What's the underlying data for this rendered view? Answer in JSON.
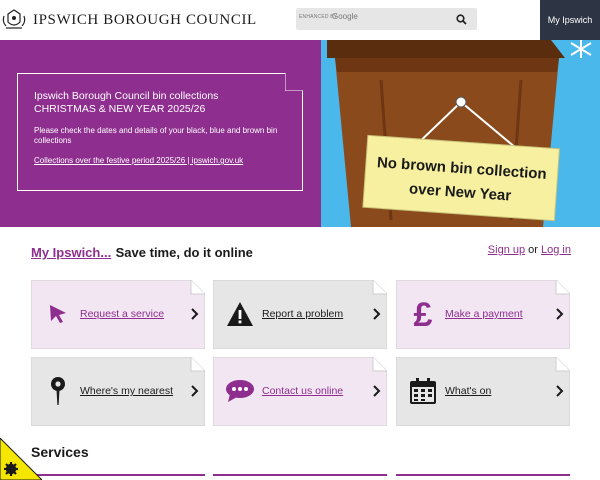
{
  "header": {
    "logo_text": "IPSWICH BOROUGH COUNCIL",
    "search": {
      "badge": "ENHANCED BY",
      "brand": "Google",
      "placeholder": ""
    },
    "my_ipswich_label": "My Ipswich"
  },
  "banner": {
    "title": "Ipswich Borough Council bin collections CHRISTMAS & NEW YEAR 2025/26",
    "description": "Please check the dates and details of your black, blue and brown bin collections",
    "link_text": "Collections over the festive period 2025/26 | ipswich.gov.uk",
    "sign_text_line1": "No brown bin collection",
    "sign_text_line2": "over New Year"
  },
  "my_ipswich_row": {
    "link_text": "My Ipswich...",
    "tagline": "Save time, do it online",
    "sign_up": "Sign up",
    "or": "or",
    "log_in": "Log in"
  },
  "tiles": [
    {
      "label": "Request a service",
      "icon": "cursor-arrow-icon",
      "bg": "#f1e6f1",
      "label_color": "purple"
    },
    {
      "label": "Report a problem",
      "icon": "warning-icon",
      "bg": "#e6e6e6",
      "label_color": "dark"
    },
    {
      "label": "Make a payment",
      "icon": "pound-icon",
      "bg": "#f1e6f1",
      "label_color": "purple"
    },
    {
      "label": "Where's my nearest",
      "icon": "map-pin-icon",
      "bg": "#e6e6e6",
      "label_color": "dark"
    },
    {
      "label": "Contact us online",
      "icon": "chat-icon",
      "bg": "#f1e6f1",
      "label_color": "purple"
    },
    {
      "label": "What's on",
      "icon": "calendar-icon",
      "bg": "#e6e6e6",
      "label_color": "dark"
    }
  ],
  "services": {
    "title": "Services"
  },
  "colors": {
    "brand_purple": "#8e2e8e",
    "dark_navy": "#2d3545",
    "sky_blue": "#4ab8ea",
    "bin_brown": "#8a4a1c",
    "sign_yellow": "#f6f0a0",
    "a11y_yellow": "#f5e600"
  }
}
